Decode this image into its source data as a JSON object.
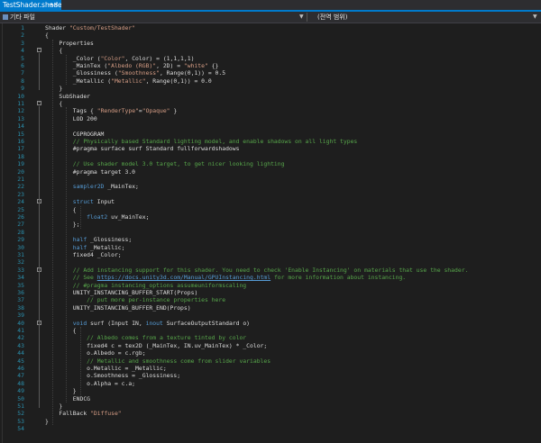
{
  "tab": {
    "title": "TestShader.shader",
    "pin": "→×"
  },
  "navbar": {
    "left_label": "기타 파일",
    "right_label": "(전역 범위)"
  },
  "colors": {
    "accent": "#007acc",
    "background": "#1e1e1e",
    "line_numbers": "#2b91af",
    "string": "#d69d85",
    "comment": "#57a64a",
    "keyword": "#569cd6"
  },
  "code_lines": [
    {
      "n": "1",
      "fold": "",
      "parts": [
        [
          "pl",
          "Shader "
        ],
        [
          "str",
          "\"Custom/TestShader\""
        ]
      ]
    },
    {
      "n": "2",
      "fold": "",
      "parts": [
        [
          "pl",
          "{"
        ]
      ]
    },
    {
      "n": "3",
      "fold": "",
      "parts": [
        [
          "pl",
          "    Properties"
        ]
      ]
    },
    {
      "n": "4",
      "fold": "-",
      "parts": [
        [
          "pl",
          "    {"
        ]
      ]
    },
    {
      "n": "5",
      "fold": "",
      "parts": [
        [
          "pl",
          "        _Color ("
        ],
        [
          "str",
          "\"Color\""
        ],
        [
          "pl",
          ", Color) = (1,1,1,1)"
        ]
      ]
    },
    {
      "n": "6",
      "fold": "",
      "parts": [
        [
          "pl",
          "        _MainTex ("
        ],
        [
          "str",
          "\"Albedo (RGB)\""
        ],
        [
          "pl",
          ", 2D) = "
        ],
        [
          "str",
          "\"white\""
        ],
        [
          "pl",
          " {}"
        ]
      ]
    },
    {
      "n": "7",
      "fold": "",
      "parts": [
        [
          "pl",
          "        _Glossiness ("
        ],
        [
          "str",
          "\"Smoothness\""
        ],
        [
          "pl",
          ", Range(0,1)) = 0.5"
        ]
      ]
    },
    {
      "n": "8",
      "fold": "",
      "parts": [
        [
          "pl",
          "        _Metallic ("
        ],
        [
          "str",
          "\"Metallic\""
        ],
        [
          "pl",
          ", Range(0,1)) = 0.0"
        ]
      ]
    },
    {
      "n": "9",
      "fold": "",
      "parts": [
        [
          "pl",
          "    }"
        ]
      ]
    },
    {
      "n": "10",
      "fold": "",
      "parts": [
        [
          "pl",
          "    SubShader"
        ]
      ]
    },
    {
      "n": "11",
      "fold": "-",
      "parts": [
        [
          "pl",
          "    {"
        ]
      ]
    },
    {
      "n": "12",
      "fold": "",
      "parts": [
        [
          "pl",
          "        Tags { "
        ],
        [
          "str",
          "\"RenderType\""
        ],
        [
          "pl",
          "="
        ],
        [
          "str",
          "\"Opaque\""
        ],
        [
          "pl",
          " }"
        ]
      ]
    },
    {
      "n": "13",
      "fold": "",
      "parts": [
        [
          "pl",
          "        LOD 200"
        ]
      ]
    },
    {
      "n": "14",
      "fold": "",
      "parts": []
    },
    {
      "n": "15",
      "fold": "",
      "parts": [
        [
          "pl",
          "        CGPROGRAM"
        ]
      ]
    },
    {
      "n": "16",
      "fold": "",
      "parts": [
        [
          "com",
          "        // Physically based Standard lighting model, and enable shadows on all light types"
        ]
      ]
    },
    {
      "n": "17",
      "fold": "",
      "parts": [
        [
          "pl",
          "        #pragma surface surf Standard fullforwardshadows"
        ]
      ]
    },
    {
      "n": "18",
      "fold": "",
      "parts": []
    },
    {
      "n": "19",
      "fold": "",
      "parts": [
        [
          "com",
          "        // Use shader model 3.0 target, to get nicer looking lighting"
        ]
      ]
    },
    {
      "n": "20",
      "fold": "",
      "parts": [
        [
          "pl",
          "        #pragma target 3.0"
        ]
      ]
    },
    {
      "n": "21",
      "fold": "",
      "parts": []
    },
    {
      "n": "22",
      "fold": "",
      "parts": [
        [
          "kw",
          "        sampler2D"
        ],
        [
          "pl",
          " _MainTex;"
        ]
      ]
    },
    {
      "n": "23",
      "fold": "",
      "parts": []
    },
    {
      "n": "24",
      "fold": "-",
      "parts": [
        [
          "kw",
          "        struct"
        ],
        [
          "pl",
          " Input"
        ]
      ]
    },
    {
      "n": "25",
      "fold": "",
      "parts": [
        [
          "pl",
          "        {"
        ]
      ]
    },
    {
      "n": "26",
      "fold": "",
      "parts": [
        [
          "kw",
          "            float2"
        ],
        [
          "pl",
          " uv_MainTex;"
        ]
      ]
    },
    {
      "n": "27",
      "fold": "",
      "parts": [
        [
          "pl",
          "        };"
        ]
      ]
    },
    {
      "n": "28",
      "fold": "",
      "parts": []
    },
    {
      "n": "29",
      "fold": "",
      "parts": [
        [
          "kw",
          "        half"
        ],
        [
          "pl",
          " _Glossiness;"
        ]
      ]
    },
    {
      "n": "30",
      "fold": "",
      "parts": [
        [
          "kw",
          "        half"
        ],
        [
          "pl",
          " _Metallic;"
        ]
      ]
    },
    {
      "n": "31",
      "fold": "",
      "parts": [
        [
          "pl",
          "        fixed4 _Color;"
        ]
      ]
    },
    {
      "n": "32",
      "fold": "",
      "parts": []
    },
    {
      "n": "33",
      "fold": "-",
      "parts": [
        [
          "com",
          "        // Add instancing support for this shader. You need to check 'Enable Instancing' on materials that use the shader."
        ]
      ]
    },
    {
      "n": "34",
      "fold": "",
      "parts": [
        [
          "com",
          "        // See "
        ],
        [
          "link",
          "https://docs.unity3d.com/Manual/GPUInstancing.html"
        ],
        [
          "com",
          " for more information about instancing."
        ]
      ]
    },
    {
      "n": "35",
      "fold": "",
      "parts": [
        [
          "com",
          "        // #pragma instancing_options assumeuniformscaling"
        ]
      ]
    },
    {
      "n": "36",
      "fold": "",
      "parts": [
        [
          "pl",
          "        UNITY_INSTANCING_BUFFER_START(Props)"
        ]
      ]
    },
    {
      "n": "37",
      "fold": "",
      "parts": [
        [
          "com",
          "            // put more per-instance properties here"
        ]
      ]
    },
    {
      "n": "38",
      "fold": "",
      "parts": [
        [
          "pl",
          "        UNITY_INSTANCING_BUFFER_END(Props)"
        ]
      ]
    },
    {
      "n": "39",
      "fold": "",
      "parts": []
    },
    {
      "n": "40",
      "fold": "-",
      "parts": [
        [
          "kw",
          "        void"
        ],
        [
          "pl",
          " surf (Input IN, "
        ],
        [
          "kw",
          "inout"
        ],
        [
          "pl",
          " SurfaceOutputStandard o)"
        ]
      ]
    },
    {
      "n": "41",
      "fold": "",
      "parts": [
        [
          "pl",
          "        {"
        ]
      ]
    },
    {
      "n": "42",
      "fold": "",
      "parts": [
        [
          "com",
          "            // Albedo comes from a texture tinted by color"
        ]
      ]
    },
    {
      "n": "43",
      "fold": "",
      "parts": [
        [
          "pl",
          "            fixed4 c = tex2D (_MainTex, IN.uv_MainTex) * _Color;"
        ]
      ]
    },
    {
      "n": "44",
      "fold": "",
      "parts": [
        [
          "pl",
          "            o.Albedo = c.rgb;"
        ]
      ]
    },
    {
      "n": "45",
      "fold": "",
      "parts": [
        [
          "com",
          "            // Metallic and smoothness come from slider variables"
        ]
      ]
    },
    {
      "n": "46",
      "fold": "",
      "parts": [
        [
          "pl",
          "            o.Metallic = _Metallic;"
        ]
      ]
    },
    {
      "n": "47",
      "fold": "",
      "parts": [
        [
          "pl",
          "            o.Smoothness = _Glossiness;"
        ]
      ]
    },
    {
      "n": "48",
      "fold": "",
      "parts": [
        [
          "pl",
          "            o.Alpha = c.a;"
        ]
      ]
    },
    {
      "n": "49",
      "fold": "",
      "parts": [
        [
          "pl",
          "        }"
        ]
      ]
    },
    {
      "n": "50",
      "fold": "",
      "parts": [
        [
          "pl",
          "        ENDCG"
        ]
      ]
    },
    {
      "n": "51",
      "fold": "",
      "parts": [
        [
          "pl",
          "    }"
        ]
      ]
    },
    {
      "n": "52",
      "fold": "",
      "parts": [
        [
          "pl",
          "    FallBack "
        ],
        [
          "str",
          "\"Diffuse\""
        ]
      ]
    },
    {
      "n": "53",
      "fold": "",
      "parts": [
        [
          "pl",
          "}"
        ]
      ]
    },
    {
      "n": "54",
      "fold": "",
      "parts": []
    }
  ]
}
